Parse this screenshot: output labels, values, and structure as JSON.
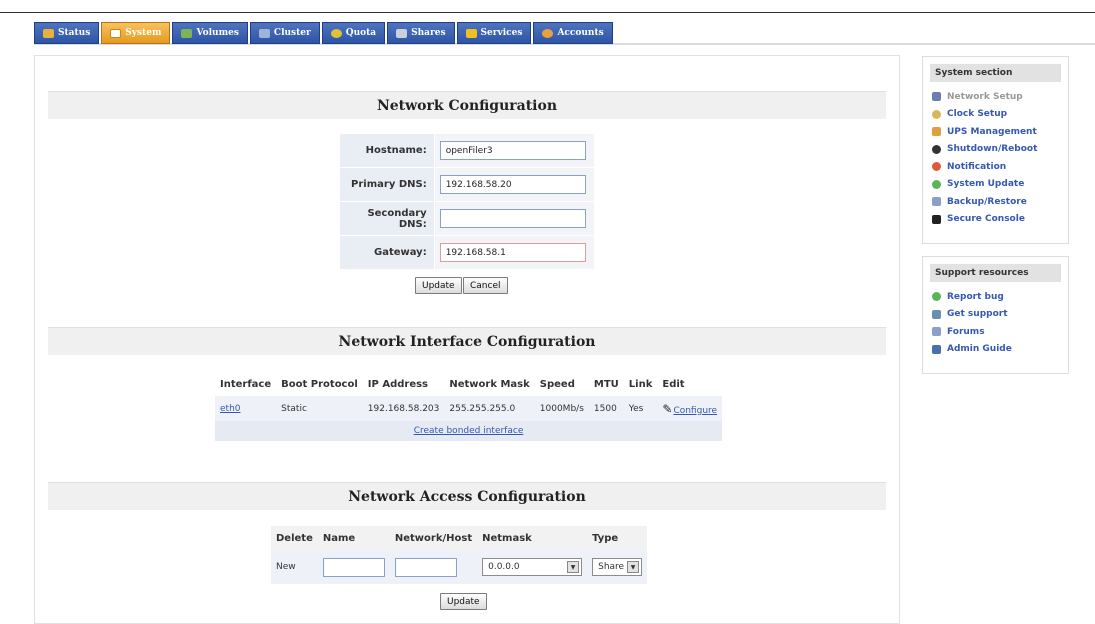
{
  "tabs": [
    {
      "label": "Status",
      "color": "#e8b23a",
      "active": false
    },
    {
      "label": "System",
      "color": "#ffffff",
      "active": true
    },
    {
      "label": "Volumes",
      "color": "#7fb35a",
      "active": false
    },
    {
      "label": "Cluster",
      "color": "#9db3d8",
      "active": false
    },
    {
      "label": "Quota",
      "color": "#e0c23a",
      "active": false
    },
    {
      "label": "Shares",
      "color": "#c9d0dc",
      "active": false
    },
    {
      "label": "Services",
      "color": "#f0c020",
      "active": false
    },
    {
      "label": "Accounts",
      "color": "#e8a040",
      "active": false
    }
  ],
  "network_config": {
    "title": "Network Configuration",
    "hostname_label": "Hostname:",
    "hostname_value": "openFiler3",
    "primary_dns_label": "Primary DNS:",
    "primary_dns_value": "192.168.58.20",
    "secondary_dns_label": "Secondary DNS:",
    "secondary_dns_value": "",
    "gateway_label": "Gateway:",
    "gateway_value": "192.168.58.1",
    "update_label": "Update",
    "cancel_label": "Cancel"
  },
  "interface_config": {
    "title": "Network Interface Configuration",
    "columns": [
      "Interface",
      "Boot Protocol",
      "IP Address",
      "Network Mask",
      "Speed",
      "MTU",
      "Link",
      "Edit"
    ],
    "row": {
      "interface": "eth0",
      "boot_protocol": "Static",
      "ip_address": "192.168.58.203",
      "network_mask": "255.255.255.0",
      "speed": "1000Mb/s",
      "mtu": "1500",
      "link": "Yes",
      "edit": "Configure"
    },
    "bonded_link": "Create bonded interface"
  },
  "access_config": {
    "title": "Network Access Configuration",
    "columns": [
      "Delete",
      "Name",
      "Network/Host",
      "Netmask",
      "Type"
    ],
    "row": {
      "delete": "New",
      "name": "",
      "network_host": "",
      "netmask": "0.0.0.0",
      "type": "Share"
    },
    "update_label": "Update"
  },
  "system_section": {
    "title": "System section",
    "items": [
      {
        "label": "Network Setup",
        "icon": "wrench-icon",
        "color": "#6a7fb0",
        "current": true
      },
      {
        "label": "Clock Setup",
        "icon": "clock-icon",
        "color": "#d6b85a"
      },
      {
        "label": "UPS Management",
        "icon": "battery-icon",
        "color": "#e0a040"
      },
      {
        "label": "Shutdown/Reboot",
        "icon": "power-icon",
        "color": "#333333"
      },
      {
        "label": "Notification",
        "icon": "notification-icon",
        "color": "#e05a3a"
      },
      {
        "label": "System Update",
        "icon": "update-icon",
        "color": "#5ab35a"
      },
      {
        "label": "Backup/Restore",
        "icon": "backup-icon",
        "color": "#8aa0c8"
      },
      {
        "label": "Secure Console",
        "icon": "console-icon",
        "color": "#222222"
      }
    ]
  },
  "support_resources": {
    "title": "Support resources",
    "items": [
      {
        "label": "Report bug",
        "icon": "bug-icon",
        "color": "#5ab35a"
      },
      {
        "label": "Get support",
        "icon": "support-icon",
        "color": "#6a8fb0"
      },
      {
        "label": "Forums",
        "icon": "forums-icon",
        "color": "#8aa0c8"
      },
      {
        "label": "Admin Guide",
        "icon": "book-icon",
        "color": "#4a6fb0"
      }
    ]
  }
}
